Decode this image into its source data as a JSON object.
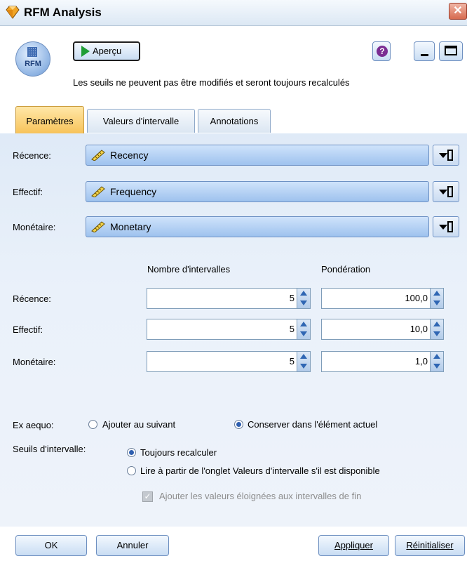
{
  "window": {
    "title": "RFM Analysis",
    "close_glyph": "✕"
  },
  "header": {
    "node_icon_label": "RFM",
    "preview_label": "Aperçu",
    "help_glyph": "?",
    "info_text": "Les seuils ne peuvent pas être modifiés et seront toujours recalculés"
  },
  "tabs": [
    {
      "label": "Paramètres",
      "active": true
    },
    {
      "label": "Valeurs d'intervalle",
      "active": false
    },
    {
      "label": "Annotations",
      "active": false
    }
  ],
  "fields": [
    {
      "label": "Récence:",
      "value": "Recency",
      "icon": "ruler-icon"
    },
    {
      "label": "Effectif:",
      "value": "Frequency",
      "icon": "ruler-icon"
    },
    {
      "label": "Monétaire:",
      "value": "Monetary",
      "icon": "ruler-icon"
    }
  ],
  "binning": {
    "col_bins": "Nombre d'intervalles",
    "col_weight": "Pondération",
    "rows": [
      {
        "label": "Récence:",
        "bins": "5",
        "weight": "100,0"
      },
      {
        "label": "Effectif:",
        "bins": "5",
        "weight": "10,0"
      },
      {
        "label": "Monétaire:",
        "bins": "5",
        "weight": "1,0"
      }
    ]
  },
  "ties": {
    "label": "Ex aequo:",
    "options": [
      {
        "label": "Ajouter au suivant",
        "selected": false
      },
      {
        "label": "Conserver dans l'élément actuel",
        "selected": true
      }
    ]
  },
  "thresholds": {
    "label": "Seuils d'intervalle:",
    "options": [
      {
        "label": "Toujours recalculer",
        "selected": true
      },
      {
        "label": "Lire à partir de l'onglet Valeurs d'intervalle s'il est disponible",
        "selected": false
      }
    ],
    "outliers_checkbox": {
      "label": "Ajouter les valeurs éloignées aux intervalles de fin",
      "checked": true,
      "enabled": false
    }
  },
  "footer": {
    "ok": "OK",
    "cancel": "Annuler",
    "apply": "Appliquer",
    "reset": "Réinitialiser"
  },
  "colors": {
    "active_tab": "#f7c35a",
    "field_box": "#9ec2ee",
    "panel": "#dfeaf7"
  }
}
